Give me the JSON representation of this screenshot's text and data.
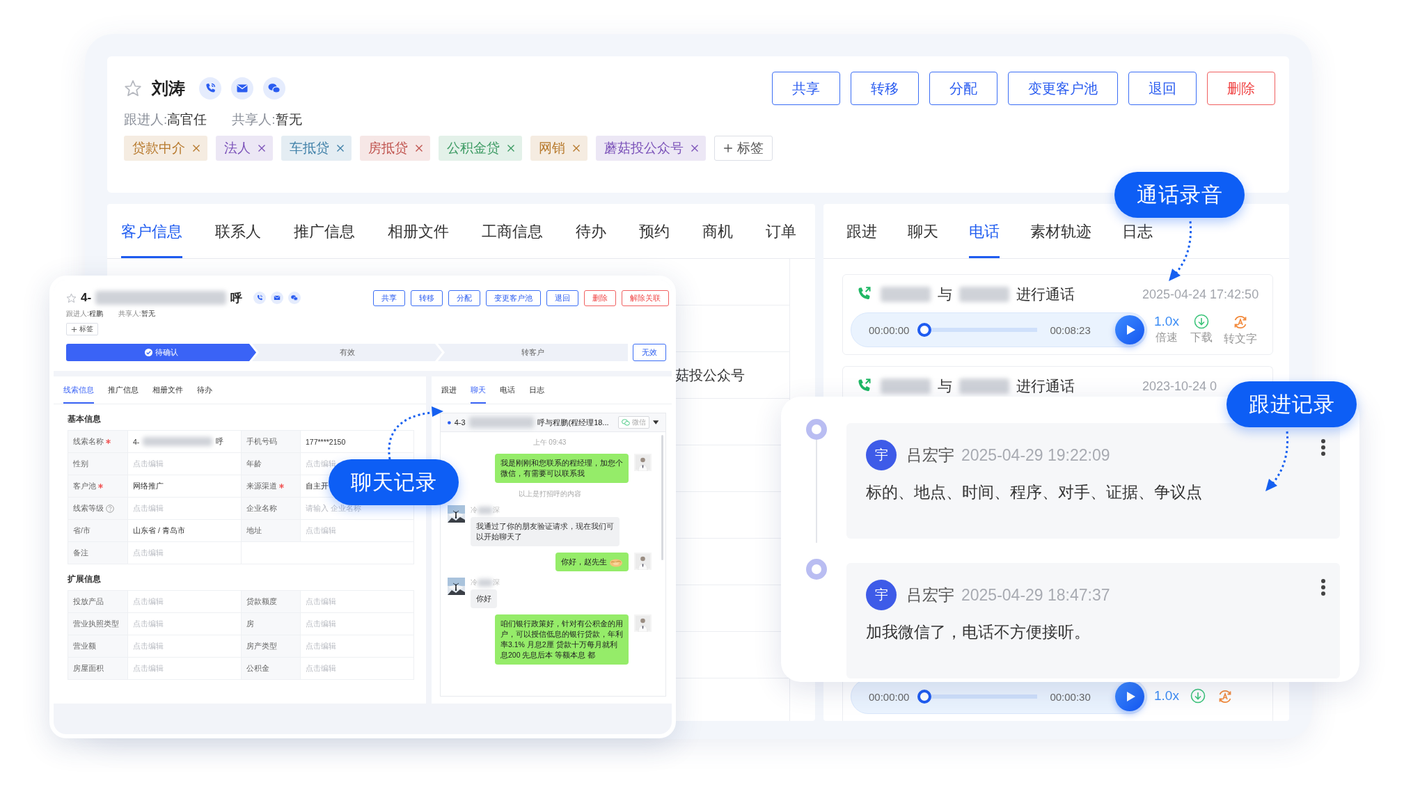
{
  "customer": {
    "starred": false,
    "name": "刘涛",
    "actions": [
      {
        "label": "共享",
        "kind": "normal"
      },
      {
        "label": "转移",
        "kind": "normal"
      },
      {
        "label": "分配",
        "kind": "normal"
      },
      {
        "label": "变更客户池",
        "kind": "normal"
      },
      {
        "label": "退回",
        "kind": "normal"
      },
      {
        "label": "删除",
        "kind": "danger"
      }
    ],
    "owner_label": "跟进人:",
    "owner": "高官任",
    "sharer_label": "共享人:",
    "sharer": "暂无",
    "tags": [
      {
        "label": "贷款中介",
        "color": "#b7792c"
      },
      {
        "label": "法人",
        "color": "#7b52b9"
      },
      {
        "label": "车抵贷",
        "color": "#3f80a8"
      },
      {
        "label": "房抵贷",
        "color": "#c0544f"
      },
      {
        "label": "公积金贷",
        "color": "#3b9a62"
      },
      {
        "label": "网销",
        "color": "#b7792c"
      },
      {
        "label": "蘑菇投公众号",
        "color": "#7b52b9"
      }
    ],
    "add_tag": "标签",
    "info_tabs": [
      {
        "label": "客户信息",
        "selected": true
      },
      {
        "label": "联系人",
        "selected": false
      },
      {
        "label": "推广信息",
        "selected": false
      },
      {
        "label": "相册文件",
        "selected": false
      },
      {
        "label": "工商信息",
        "selected": false
      },
      {
        "label": "待办",
        "selected": false
      },
      {
        "label": "预约",
        "selected": false
      },
      {
        "label": "商机",
        "selected": false
      },
      {
        "label": "订单",
        "selected": false
      }
    ],
    "info_visible_text": "菇投公众号",
    "activity_tabs": [
      {
        "label": "跟进",
        "selected": false
      },
      {
        "label": "聊天",
        "selected": false
      },
      {
        "label": "电话",
        "selected": true
      },
      {
        "label": "素材轨迹",
        "selected": false
      },
      {
        "label": "日志",
        "selected": false
      }
    ],
    "calls": [
      {
        "joiner": "与",
        "action": "进行通话",
        "time": "2025-04-24 17:42:50",
        "player": {
          "start": "00:00:00",
          "end": "00:08:23",
          "level": 0,
          "speed": "1.0x",
          "speed_label": "倍速",
          "download_label": "下载",
          "transcribe_label": "转文字"
        }
      },
      {
        "joiner": "与",
        "action": "进行通话",
        "time": "2023-10-24 0",
        "player": {
          "start": "00:00:00",
          "end": "00:00:30",
          "level": 0,
          "speed": "1.0x"
        }
      }
    ]
  },
  "lead": {
    "starred": false,
    "name_start": "4-",
    "name_end": "呼",
    "actions": [
      {
        "label": "共享",
        "kind": "normal"
      },
      {
        "label": "转移",
        "kind": "normal"
      },
      {
        "label": "分配",
        "kind": "normal"
      },
      {
        "label": "变更客户池",
        "kind": "normal"
      },
      {
        "label": "退回",
        "kind": "normal"
      },
      {
        "label": "删除",
        "kind": "danger"
      },
      {
        "label": "解除关联",
        "kind": "danger"
      }
    ],
    "owner_label": "跟进人:",
    "owner": "程鹏",
    "sharer_label": "共享人:",
    "sharer": "暂无",
    "add_tag": "标签",
    "stages": [
      {
        "label": "待确认",
        "selected": true
      },
      {
        "label": "有效",
        "selected": false
      },
      {
        "label": "转客户",
        "selected": false
      }
    ],
    "invalid_action": "无效",
    "info_tabs": [
      {
        "label": "线索信息",
        "selected": true
      },
      {
        "label": "推广信息",
        "selected": false
      },
      {
        "label": "相册文件",
        "selected": false
      },
      {
        "label": "待办",
        "selected": false
      }
    ],
    "sections": [
      {
        "title": "基本信息",
        "fields": [
          {
            "label": "线索名称",
            "required": true,
            "help": false,
            "value": "4-",
            "value_end": "呼"
          },
          {
            "label": "手机号码",
            "required": false,
            "help": false,
            "value": "177****2150"
          },
          {
            "label": "性别",
            "required": false,
            "help": false,
            "placeholder": "点击编辑"
          },
          {
            "label": "年龄",
            "required": false,
            "help": false,
            "placeholder": "点击编辑"
          },
          {
            "label": "客户池",
            "required": true,
            "help": false,
            "value": "网络推广"
          },
          {
            "label": "来源渠道",
            "required": true,
            "help": false,
            "value": "自主开"
          },
          {
            "label": "线索等级",
            "required": false,
            "help": true,
            "placeholder": "点击编辑"
          },
          {
            "label": "企业名称",
            "required": false,
            "help": false,
            "placeholder": "请输入 企业名称"
          },
          {
            "label": "省/市",
            "required": false,
            "help": false,
            "value": "山东省 / 青岛市"
          },
          {
            "label": "地址",
            "required": false,
            "help": false,
            "placeholder": "点击编辑"
          },
          {
            "label": "备注",
            "required": false,
            "help": false,
            "placeholder": "点击编辑"
          }
        ]
      },
      {
        "title": "扩展信息",
        "fields": [
          {
            "label": "投放产品",
            "required": false,
            "help": false,
            "placeholder": "点击编辑"
          },
          {
            "label": "贷款额度",
            "required": false,
            "help": false,
            "placeholder": "点击编辑"
          },
          {
            "label": "营业执照类型",
            "required": false,
            "help": false,
            "placeholder": "点击编辑"
          },
          {
            "label": "房",
            "required": false,
            "help": false,
            "placeholder": "点击编辑"
          },
          {
            "label": "营业额",
            "required": false,
            "help": false,
            "placeholder": "点击编辑"
          },
          {
            "label": "房产类型",
            "required": false,
            "help": false,
            "placeholder": "点击编辑"
          },
          {
            "label": "房屋面积",
            "required": false,
            "help": false,
            "placeholder": "点击编辑"
          },
          {
            "label": "公积金",
            "required": false,
            "help": false,
            "placeholder": "点击编辑"
          }
        ]
      }
    ],
    "activity_tabs": [
      {
        "label": "跟进",
        "selected": false
      },
      {
        "label": "聊天",
        "selected": true
      },
      {
        "label": "电话",
        "selected": false
      },
      {
        "label": "日志",
        "selected": false
      }
    ],
    "chat": {
      "contact_start": "4-3",
      "contact_end": "呼与程鹏(程经理18...",
      "channel": "微信",
      "messages": [
        {
          "kind": "time",
          "text": "上午 09:43"
        },
        {
          "kind": "sent",
          "text": "我是刚刚和您联系的程经理，加您个微信，有需要可以联系我",
          "sticker": false
        },
        {
          "kind": "notice",
          "text": "以上是打招呼的内容"
        },
        {
          "kind": "received",
          "sender_start": "冷",
          "sender_end": "深",
          "text": "我通过了你的朋友验证请求，现在我们可以开始聊天了"
        },
        {
          "kind": "sent",
          "text": "你好，赵先生",
          "sticker": true
        },
        {
          "kind": "received",
          "sender_start": "冷",
          "sender_end": "深",
          "text": "你好"
        },
        {
          "kind": "sent",
          "text": "咱们银行政策好，针对有公积金的用户，可以授信低息的银行贷款，年利率3.1% 月息2厘 贷款十万每月就利息200 先息后本 等额本息 都",
          "sticker": false
        }
      ]
    }
  },
  "followups": [
    {
      "avatar": "宇",
      "author": "吕宏宇",
      "time": "2025-04-29 19:22:09",
      "text": "标的、地点、时间、程序、对手、证据、争议点"
    },
    {
      "avatar": "宇",
      "author": "吕宏宇",
      "time": "2025-04-29 18:47:37",
      "text": "加我微信了，电话不方便接听。"
    }
  ],
  "callouts": [
    {
      "kind": "calls",
      "label": "通话录音"
    },
    {
      "kind": "followups",
      "label": "跟进记录"
    },
    {
      "kind": "chat",
      "label": "聊天记录"
    }
  ]
}
